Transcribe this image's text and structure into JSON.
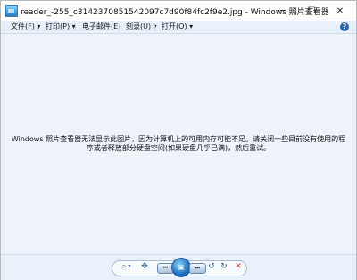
{
  "window": {
    "title": "reader_-255_c3142370851542097c7d90f84fc2f9e2.jpg - Windows 照片查看器"
  },
  "window_controls": {
    "minimize": "─",
    "maximize": "☐",
    "close": "✕"
  },
  "menu": {
    "items": [
      {
        "label": "文件(F) ▾"
      },
      {
        "label": "打印(P) ▾"
      },
      {
        "label": "电子邮件(E)"
      },
      {
        "label": "刻录(U) ▾"
      },
      {
        "label": "打开(O) ▾"
      }
    ],
    "help": "?"
  },
  "content": {
    "message": "Windows 照片查看器无法显示此图片，因为计算机上的可用内存可能不足。请关闭一些目前没有使用的程序或者释放部分硬盘空间(如果硬盘几乎已满)，然后重试。"
  },
  "controls": {
    "zoom": "⌕",
    "zoom_caret": "▾",
    "fit": "✥",
    "prev": "⏮",
    "play": "▣",
    "next": "⏭",
    "rotate_left": "↺",
    "rotate_right": "↻",
    "delete": "✕"
  },
  "icons": {
    "app": "photo-viewer-icon",
    "help": "help-icon",
    "zoom": "zoom-icon",
    "fit": "actual-size-icon",
    "prev": "previous-icon",
    "play": "slideshow-icon",
    "next": "next-icon",
    "rotate_left": "rotate-counterclockwise-icon",
    "rotate_right": "rotate-clockwise-icon",
    "delete": "delete-icon"
  },
  "colors": {
    "menu_bg": "#e8f0fb",
    "content_bg": "#eef3fb",
    "control_accent": "#1f6fbd",
    "delete": "#c53b3b"
  }
}
